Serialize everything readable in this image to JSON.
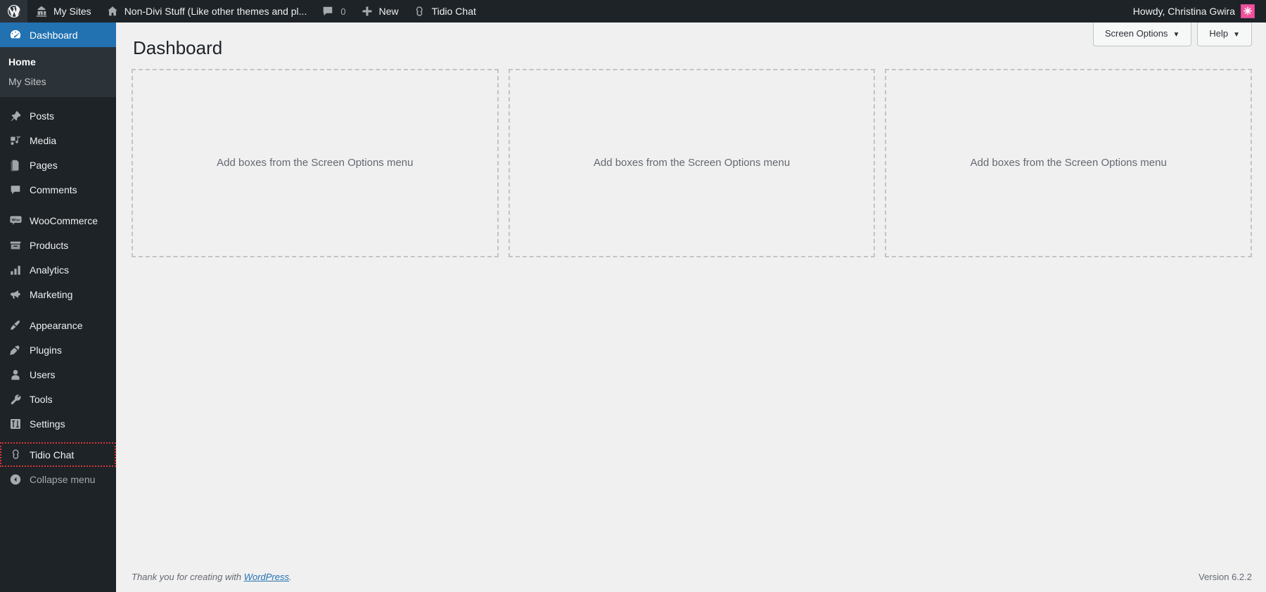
{
  "adminbar": {
    "logo_icon": "wordpress-logo-icon",
    "items": [
      {
        "icon": "my-sites-icon",
        "label": "My Sites",
        "name": "adminbar-my-sites"
      },
      {
        "icon": "site-home-icon",
        "label": "Non-Divi Stuff (Like other themes and pl...",
        "name": "adminbar-site-name"
      },
      {
        "icon": "comment-bubble-icon",
        "label": "0",
        "name": "adminbar-comments"
      },
      {
        "icon": "plus-icon",
        "label": "New",
        "name": "adminbar-new-content"
      },
      {
        "icon": "tidio-icon",
        "label": "Tidio Chat",
        "name": "adminbar-tidio-chat"
      }
    ],
    "howdy": "Howdy, Christina Gwira",
    "avatar_glyph": "✳",
    "avatar_color": "#f0509c"
  },
  "sidebar": {
    "items": [
      {
        "label": "Dashboard",
        "icon": "dashboard-icon",
        "current": true,
        "name": "sidebar-item-dashboard"
      },
      {
        "label": "Posts",
        "icon": "pin-icon",
        "name": "sidebar-item-posts"
      },
      {
        "label": "Media",
        "icon": "media-icon",
        "name": "sidebar-item-media"
      },
      {
        "label": "Pages",
        "icon": "pages-icon",
        "name": "sidebar-item-pages"
      },
      {
        "label": "Comments",
        "icon": "comment-bubble-icon",
        "name": "sidebar-item-comments"
      },
      {
        "label": "WooCommerce",
        "icon": "woocommerce-icon",
        "name": "sidebar-item-woocommerce"
      },
      {
        "label": "Products",
        "icon": "products-icon",
        "name": "sidebar-item-products"
      },
      {
        "label": "Analytics",
        "icon": "chart-bar-icon",
        "name": "sidebar-item-analytics"
      },
      {
        "label": "Marketing",
        "icon": "megaphone-icon",
        "name": "sidebar-item-marketing"
      },
      {
        "label": "Appearance",
        "icon": "paintbrush-icon",
        "name": "sidebar-item-appearance"
      },
      {
        "label": "Plugins",
        "icon": "plug-icon",
        "name": "sidebar-item-plugins"
      },
      {
        "label": "Users",
        "icon": "user-icon",
        "name": "sidebar-item-users"
      },
      {
        "label": "Tools",
        "icon": "wrench-icon",
        "name": "sidebar-item-tools"
      },
      {
        "label": "Settings",
        "icon": "settings-sliders-icon",
        "name": "sidebar-item-settings"
      },
      {
        "label": "Tidio Chat",
        "icon": "tidio-icon",
        "focused": true,
        "name": "sidebar-item-tidio-chat"
      }
    ],
    "submenu": [
      {
        "label": "Home",
        "current": true,
        "name": "submenu-item-home"
      },
      {
        "label": "My Sites",
        "current": false,
        "name": "submenu-item-my-sites"
      }
    ],
    "collapse": {
      "label": "Collapse menu",
      "icon": "collapse-arrow-icon"
    },
    "current_color": "#2271b1"
  },
  "screen_meta": {
    "screen_options": "Screen Options",
    "help": "Help",
    "caret": "▼"
  },
  "main": {
    "title": "Dashboard",
    "empty_text": "Add boxes from the Screen Options menu",
    "columns": 3
  },
  "footer": {
    "thanks_prefix": "Thank you for creating with ",
    "link": "WordPress",
    "thanks_suffix": ".",
    "version": "Version 6.2.2"
  }
}
